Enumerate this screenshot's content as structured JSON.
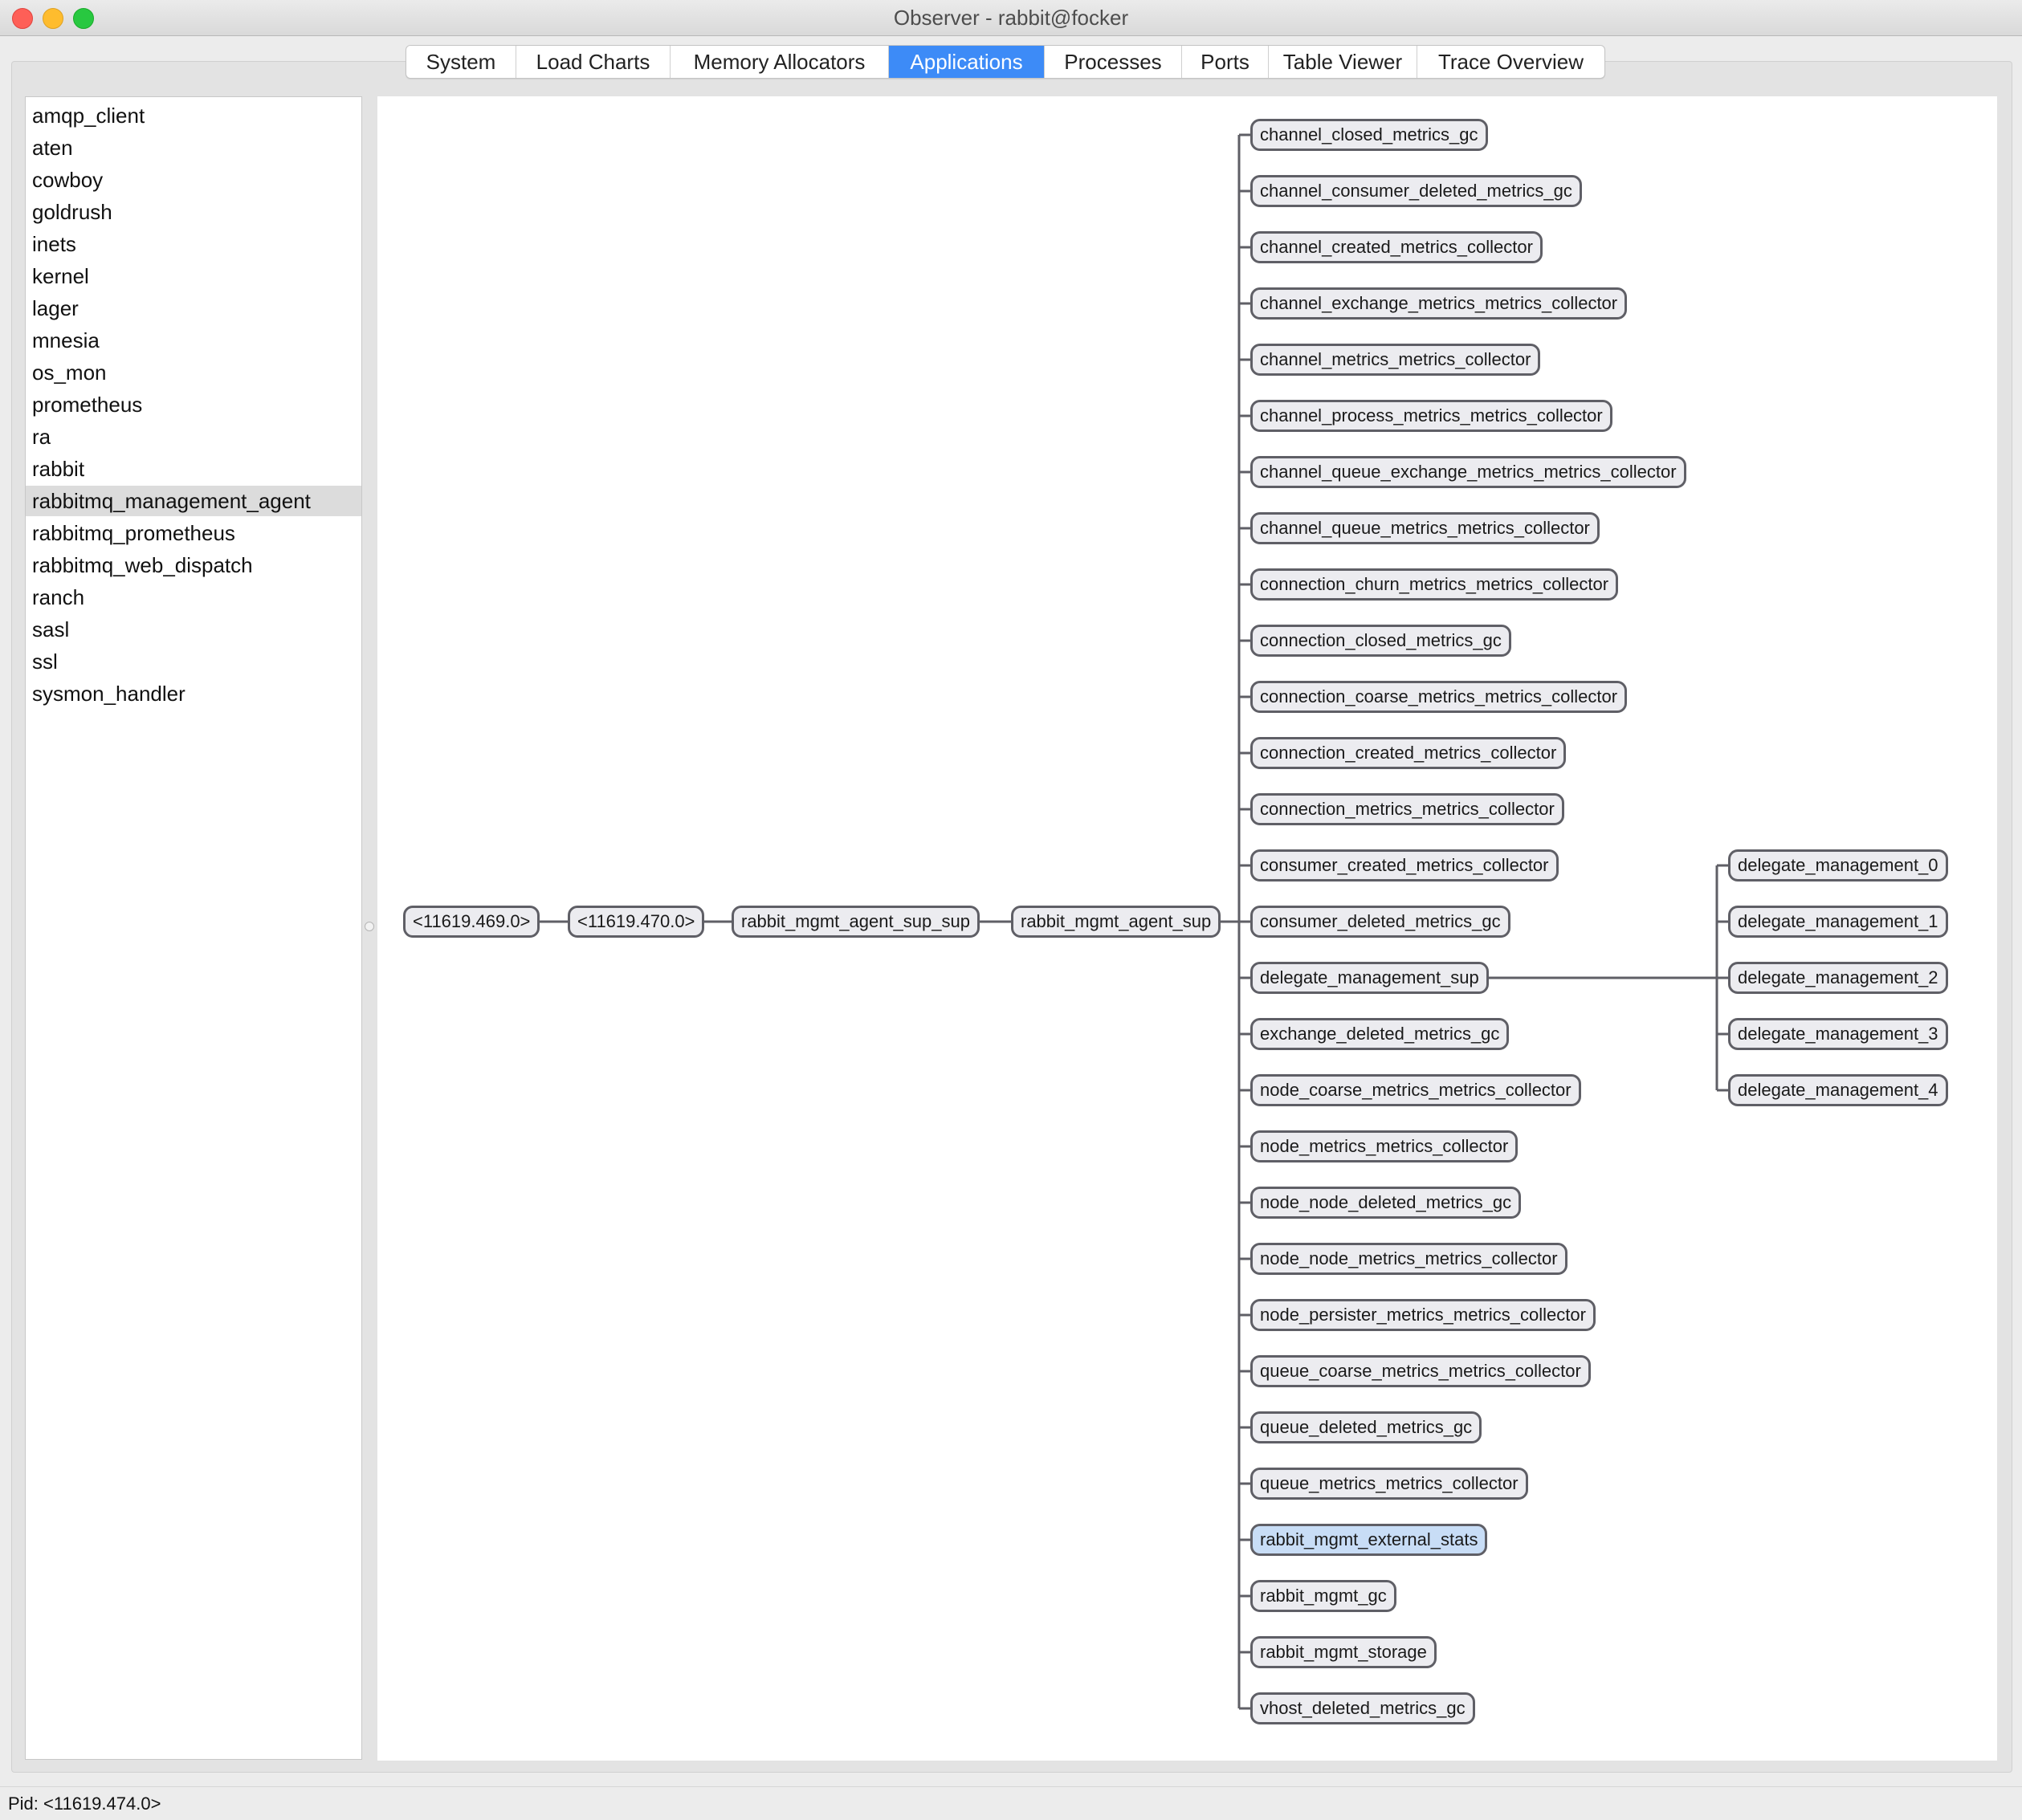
{
  "window": {
    "title": "Observer - rabbit@focker"
  },
  "tabs": [
    {
      "label": "System"
    },
    {
      "label": "Load Charts"
    },
    {
      "label": "Memory Allocators"
    },
    {
      "label": "Applications",
      "active": true
    },
    {
      "label": "Processes"
    },
    {
      "label": "Ports"
    },
    {
      "label": "Table Viewer"
    },
    {
      "label": "Trace Overview"
    }
  ],
  "apps": [
    "amqp_client",
    "aten",
    "cowboy",
    "goldrush",
    "inets",
    "kernel",
    "lager",
    "mnesia",
    "os_mon",
    "prometheus",
    "ra",
    "rabbit",
    "rabbitmq_management_agent",
    "rabbitmq_prometheus",
    "rabbitmq_web_dispatch",
    "ranch",
    "sasl",
    "ssl",
    "sysmon_handler"
  ],
  "selected_app": "rabbitmq_management_agent",
  "tree": {
    "chain": [
      "<11619.469.0>",
      "<11619.470.0>",
      "rabbit_mgmt_agent_sup_sup",
      "rabbit_mgmt_agent_sup"
    ],
    "children": [
      "channel_closed_metrics_gc",
      "channel_consumer_deleted_metrics_gc",
      "channel_created_metrics_collector",
      "channel_exchange_metrics_metrics_collector",
      "channel_metrics_metrics_collector",
      "channel_process_metrics_metrics_collector",
      "channel_queue_exchange_metrics_metrics_collector",
      "channel_queue_metrics_metrics_collector",
      "connection_churn_metrics_metrics_collector",
      "connection_closed_metrics_gc",
      "connection_coarse_metrics_metrics_collector",
      "connection_created_metrics_collector",
      "connection_metrics_metrics_collector",
      "consumer_created_metrics_collector",
      "consumer_deleted_metrics_gc",
      "delegate_management_sup",
      "exchange_deleted_metrics_gc",
      "node_coarse_metrics_metrics_collector",
      "node_metrics_metrics_collector",
      "node_node_deleted_metrics_gc",
      "node_node_metrics_metrics_collector",
      "node_persister_metrics_metrics_collector",
      "queue_coarse_metrics_metrics_collector",
      "queue_deleted_metrics_gc",
      "queue_metrics_metrics_collector",
      "rabbit_mgmt_external_stats",
      "rabbit_mgmt_gc",
      "rabbit_mgmt_storage",
      "vhost_deleted_metrics_gc"
    ],
    "delegates": [
      "delegate_management_0",
      "delegate_management_1",
      "delegate_management_2",
      "delegate_management_3",
      "delegate_management_4"
    ],
    "highlighted": "rabbit_mgmt_external_stats"
  },
  "status": {
    "text": "Pid: <11619.474.0>"
  }
}
